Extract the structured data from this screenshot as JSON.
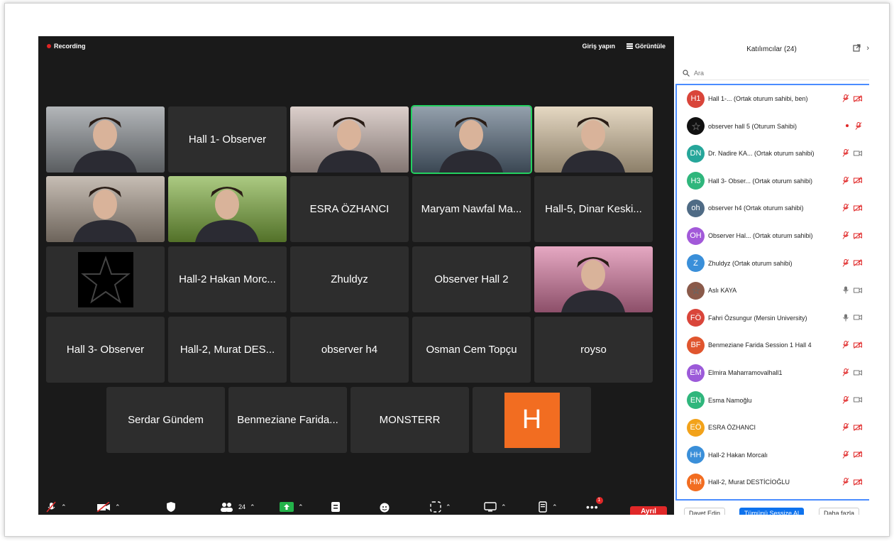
{
  "top_bar": {
    "recording_label": "Recording",
    "sign_in_label": "Giriş yapın",
    "view_label": "Görüntüle"
  },
  "tiles": [
    {
      "type": "photo",
      "name": "",
      "accent": "#8a8f94"
    },
    {
      "type": "name",
      "name": "Hall 1- Observer"
    },
    {
      "type": "photo",
      "name": "",
      "accent": "#c9b6b0"
    },
    {
      "type": "photo",
      "name": "",
      "accent": "#5a6d80",
      "active": true
    },
    {
      "type": "photo",
      "name": "",
      "accent": "#d7c3a2"
    },
    {
      "type": "photo",
      "name": "",
      "accent": "#a89a8c"
    },
    {
      "type": "photo",
      "name": "",
      "accent": "#7fae3f"
    },
    {
      "type": "name",
      "name": "ESRA ÖZHANCI"
    },
    {
      "type": "name",
      "name": "Maryam Nawfal Ma..."
    },
    {
      "type": "name",
      "name": "Hall-5, Dinar Keski..."
    },
    {
      "type": "star",
      "name": ""
    },
    {
      "type": "name",
      "name": "Hall-2 Hakan Morc..."
    },
    {
      "type": "name",
      "name": "Zhuldyz"
    },
    {
      "type": "name",
      "name": "Observer Hall 2"
    },
    {
      "type": "photo",
      "name": "",
      "accent": "#d87aa2"
    },
    {
      "type": "name",
      "name": "Hall 3- Observer"
    },
    {
      "type": "name",
      "name": "Hall-2, Murat DES..."
    },
    {
      "type": "name",
      "name": "observer h4"
    },
    {
      "type": "name",
      "name": "Osman Cem Topçu"
    },
    {
      "type": "name",
      "name": "royso"
    },
    {
      "type": "name",
      "name": "Serdar Gündem"
    },
    {
      "type": "name",
      "name": "Benmeziane Farida..."
    },
    {
      "type": "name",
      "name": "MONSTERR"
    },
    {
      "type": "avatar",
      "name": "",
      "letter": "H"
    }
  ],
  "toolbar": {
    "participants_count": "24",
    "more_badge": "1",
    "leave_label": "Ayrıl"
  },
  "panel": {
    "title": "Katılımcılar (24)",
    "search_placeholder": "Ara",
    "participants": [
      {
        "initials": "H1",
        "color": "#d9453a",
        "name": "Hall 1-...     (Ortak oturum sahibi, ben)",
        "mic": "muted",
        "cam": "off"
      },
      {
        "initials": "",
        "color": "#111111",
        "name": "observer hall 5 (Oturum Sahibi)",
        "mic": "muted",
        "cam": "dot"
      },
      {
        "initials": "DN",
        "color": "#26a69a",
        "name": "Dr. Nadire KA... (Ortak oturum sahibi)",
        "mic": "muted",
        "cam": "on"
      },
      {
        "initials": "H3",
        "color": "#2fb67c",
        "name": "Hall 3- Obser... (Ortak oturum sahibi)",
        "mic": "muted",
        "cam": "off"
      },
      {
        "initials": "oh",
        "color": "#4f6b85",
        "name": "observer h4 (Ortak oturum sahibi)",
        "mic": "muted",
        "cam": "off"
      },
      {
        "initials": "OH",
        "color": "#a259d9",
        "name": "Observer Hal...  (Ortak oturum sahibi)",
        "mic": "muted",
        "cam": "off"
      },
      {
        "initials": "Z",
        "color": "#3a8fd9",
        "name": "Zhuldyz (Ortak oturum sahibi)",
        "mic": "muted",
        "cam": "off"
      },
      {
        "initials": "",
        "color": "#8a5a4a",
        "name": "Aslı KAYA",
        "mic": "on",
        "cam": "on"
      },
      {
        "initials": "FÖ",
        "color": "#d9453a",
        "name": "Fahri Özsungur (Mersin University)",
        "mic": "on",
        "cam": "on"
      },
      {
        "initials": "BF",
        "color": "#e0552e",
        "name": "Benmeziane Farida Session 1 Hall 4",
        "mic": "muted",
        "cam": "off"
      },
      {
        "initials": "EM",
        "color": "#9c5ad9",
        "name": "Elmira Maharramovalhall1",
        "mic": "muted",
        "cam": "on"
      },
      {
        "initials": "EN",
        "color": "#2fb67c",
        "name": "Esma Namoğlu",
        "mic": "muted",
        "cam": "on"
      },
      {
        "initials": "EÖ",
        "color": "#f2a21a",
        "name": "ESRA ÖZHANCI",
        "mic": "muted",
        "cam": "off"
      },
      {
        "initials": "HH",
        "color": "#3a8fd9",
        "name": "Hall-2 Hakan Morcalı",
        "mic": "muted",
        "cam": "off"
      },
      {
        "initials": "HM",
        "color": "#f26d21",
        "name": "Hall-2, Murat DESTİCİOĞLU",
        "mic": "muted",
        "cam": "off"
      }
    ],
    "invite_label": "Davet Edin",
    "mute_all_label": "Tümünü Sessize Al",
    "more_label": "Daha fazla"
  }
}
